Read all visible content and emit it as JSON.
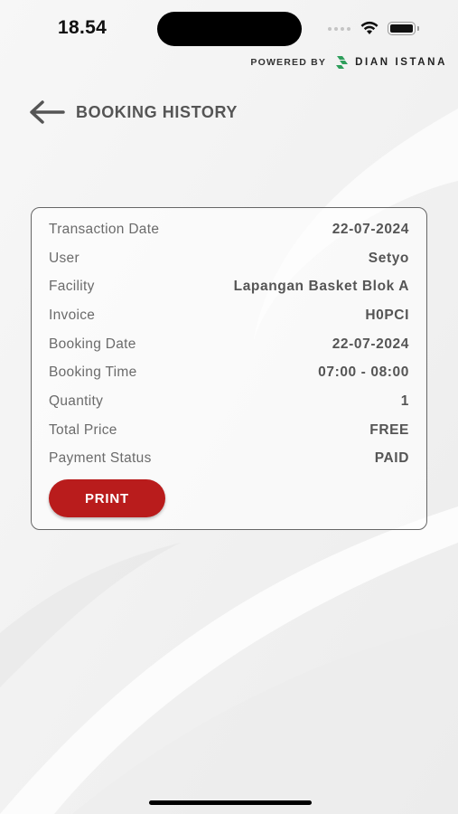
{
  "status_bar": {
    "time": "18.54"
  },
  "powered_by": {
    "label": "POWERED BY",
    "brand": "DIAN ISTANA",
    "brand_color": "#2e9e5b"
  },
  "header": {
    "title": "BOOKING HISTORY"
  },
  "booking": {
    "rows": [
      {
        "label": "Transaction Date",
        "value": "22-07-2024"
      },
      {
        "label": "User",
        "value": "Setyo"
      },
      {
        "label": "Facility",
        "value": "Lapangan Basket Blok A"
      },
      {
        "label": "Invoice",
        "value": "H0PCI"
      },
      {
        "label": "Booking Date",
        "value": "22-07-2024"
      },
      {
        "label": "Booking Time",
        "value": "07:00 - 08:00"
      },
      {
        "label": "Quantity",
        "value": "1"
      },
      {
        "label": "Total Price",
        "value": "FREE"
      },
      {
        "label": "Payment Status",
        "value": "PAID"
      }
    ],
    "print_label": "PRINT",
    "print_color": "#b91c1c"
  },
  "icons": [
    "back-arrow-icon",
    "wifi-icon",
    "battery-icon",
    "signal-icon",
    "brand-logo-icon"
  ]
}
